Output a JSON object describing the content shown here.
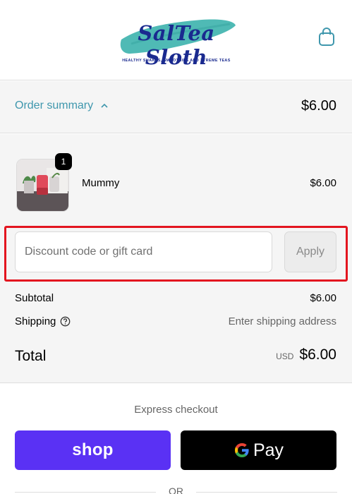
{
  "header": {
    "logo_text": "SalTea Sloth",
    "logo_tagline": "HEALTHY SHAKES, SMOOTHIES AND XTREME TEAS",
    "cart_icon": "shopping-bag-icon"
  },
  "summary": {
    "toggle_label": "Order summary",
    "toggle_icon": "chevron-up-icon",
    "total": "$6.00"
  },
  "line_item": {
    "name": "Mummy",
    "price": "$6.00",
    "quantity": "1"
  },
  "discount": {
    "placeholder": "Discount code or gift card",
    "value": "",
    "apply_label": "Apply"
  },
  "totals": {
    "subtotal_label": "Subtotal",
    "subtotal_value": "$6.00",
    "shipping_label": "Shipping",
    "shipping_icon": "help-circle-icon",
    "shipping_value": "Enter shipping address",
    "total_label": "Total",
    "currency": "USD",
    "total_value": "$6.00"
  },
  "express": {
    "heading": "Express checkout",
    "shop_label": "shop",
    "gpay_label": "Pay",
    "or_label": "OR"
  },
  "colors": {
    "accent": "#3f97ad",
    "shop_purple": "#5a31f4",
    "highlight": "#e3151f",
    "logo_navy": "#1a2a8f",
    "logo_teal": "#4fbab5"
  }
}
